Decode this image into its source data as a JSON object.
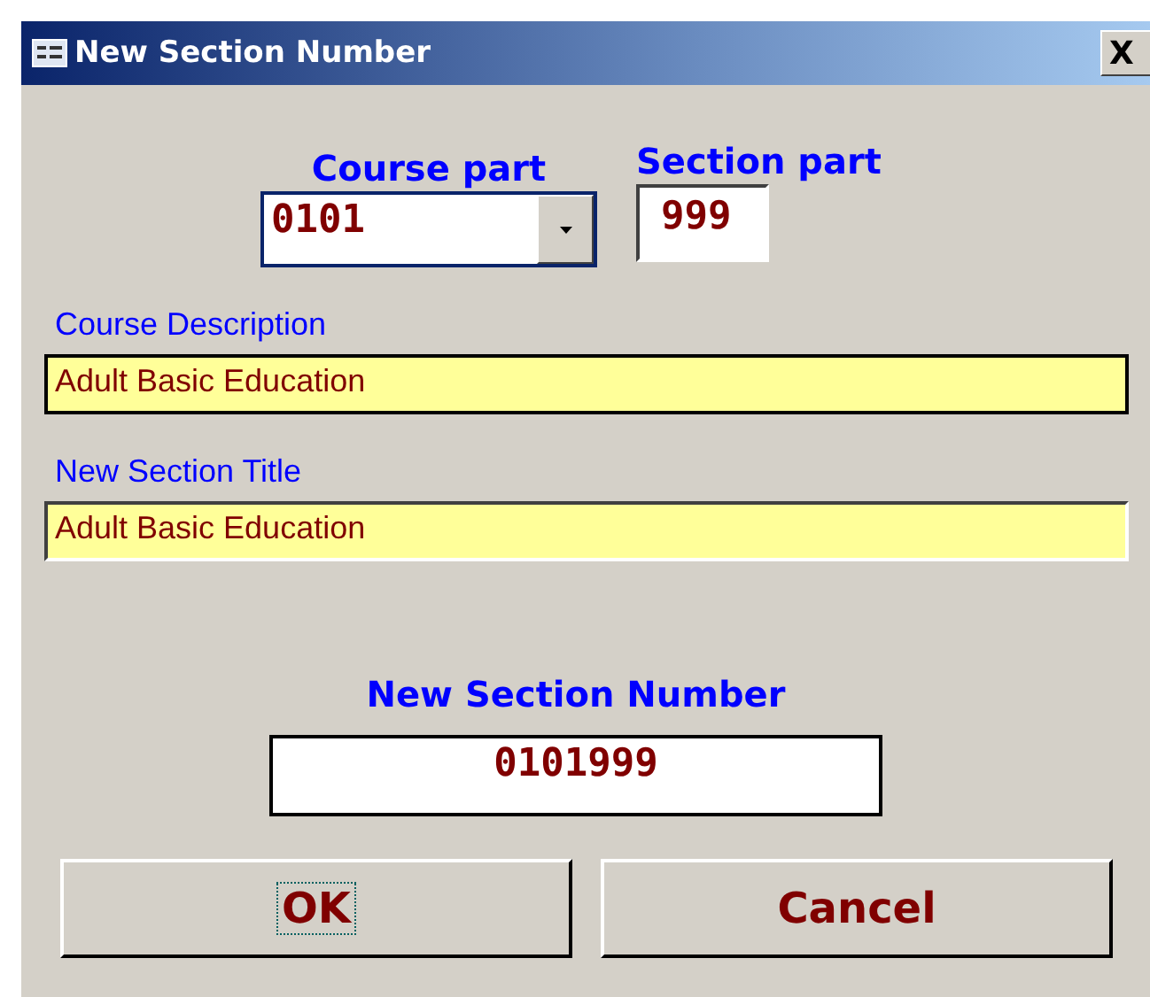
{
  "window": {
    "title": "New Section Number",
    "close": "X"
  },
  "course_part": {
    "label": "Course part",
    "value": "0101"
  },
  "section_part": {
    "label": "Section part",
    "value": "999"
  },
  "course_description": {
    "label": "Course Description",
    "value": "Adult Basic Education"
  },
  "new_section_title": {
    "label": "New Section Title",
    "value": "Adult Basic Education"
  },
  "new_section_number": {
    "label": "New Section Number",
    "value": "0101999"
  },
  "buttons": [
    {
      "label": "OK",
      "focused": true
    },
    {
      "label": "Cancel",
      "focused": false
    }
  ]
}
